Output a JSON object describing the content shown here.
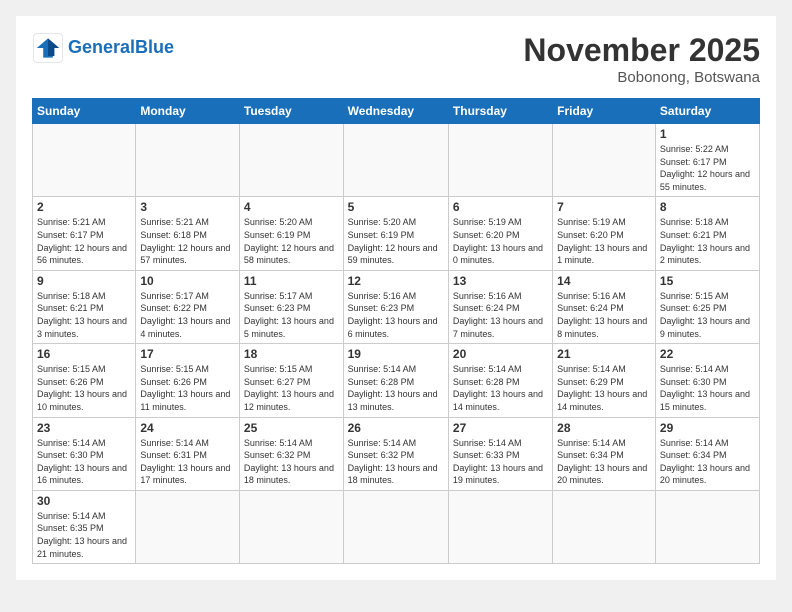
{
  "header": {
    "logo_general": "General",
    "logo_blue": "Blue",
    "month_title": "November 2025",
    "location": "Bobonong, Botswana"
  },
  "days_of_week": [
    "Sunday",
    "Monday",
    "Tuesday",
    "Wednesday",
    "Thursday",
    "Friday",
    "Saturday"
  ],
  "weeks": [
    [
      {
        "day": "",
        "info": ""
      },
      {
        "day": "",
        "info": ""
      },
      {
        "day": "",
        "info": ""
      },
      {
        "day": "",
        "info": ""
      },
      {
        "day": "",
        "info": ""
      },
      {
        "day": "",
        "info": ""
      },
      {
        "day": "1",
        "info": "Sunrise: 5:22 AM\nSunset: 6:17 PM\nDaylight: 12 hours and 55 minutes."
      }
    ],
    [
      {
        "day": "2",
        "info": "Sunrise: 5:21 AM\nSunset: 6:17 PM\nDaylight: 12 hours and 56 minutes."
      },
      {
        "day": "3",
        "info": "Sunrise: 5:21 AM\nSunset: 6:18 PM\nDaylight: 12 hours and 57 minutes."
      },
      {
        "day": "4",
        "info": "Sunrise: 5:20 AM\nSunset: 6:19 PM\nDaylight: 12 hours and 58 minutes."
      },
      {
        "day": "5",
        "info": "Sunrise: 5:20 AM\nSunset: 6:19 PM\nDaylight: 12 hours and 59 minutes."
      },
      {
        "day": "6",
        "info": "Sunrise: 5:19 AM\nSunset: 6:20 PM\nDaylight: 13 hours and 0 minutes."
      },
      {
        "day": "7",
        "info": "Sunrise: 5:19 AM\nSunset: 6:20 PM\nDaylight: 13 hours and 1 minute."
      },
      {
        "day": "8",
        "info": "Sunrise: 5:18 AM\nSunset: 6:21 PM\nDaylight: 13 hours and 2 minutes."
      }
    ],
    [
      {
        "day": "9",
        "info": "Sunrise: 5:18 AM\nSunset: 6:21 PM\nDaylight: 13 hours and 3 minutes."
      },
      {
        "day": "10",
        "info": "Sunrise: 5:17 AM\nSunset: 6:22 PM\nDaylight: 13 hours and 4 minutes."
      },
      {
        "day": "11",
        "info": "Sunrise: 5:17 AM\nSunset: 6:23 PM\nDaylight: 13 hours and 5 minutes."
      },
      {
        "day": "12",
        "info": "Sunrise: 5:16 AM\nSunset: 6:23 PM\nDaylight: 13 hours and 6 minutes."
      },
      {
        "day": "13",
        "info": "Sunrise: 5:16 AM\nSunset: 6:24 PM\nDaylight: 13 hours and 7 minutes."
      },
      {
        "day": "14",
        "info": "Sunrise: 5:16 AM\nSunset: 6:24 PM\nDaylight: 13 hours and 8 minutes."
      },
      {
        "day": "15",
        "info": "Sunrise: 5:15 AM\nSunset: 6:25 PM\nDaylight: 13 hours and 9 minutes."
      }
    ],
    [
      {
        "day": "16",
        "info": "Sunrise: 5:15 AM\nSunset: 6:26 PM\nDaylight: 13 hours and 10 minutes."
      },
      {
        "day": "17",
        "info": "Sunrise: 5:15 AM\nSunset: 6:26 PM\nDaylight: 13 hours and 11 minutes."
      },
      {
        "day": "18",
        "info": "Sunrise: 5:15 AM\nSunset: 6:27 PM\nDaylight: 13 hours and 12 minutes."
      },
      {
        "day": "19",
        "info": "Sunrise: 5:14 AM\nSunset: 6:28 PM\nDaylight: 13 hours and 13 minutes."
      },
      {
        "day": "20",
        "info": "Sunrise: 5:14 AM\nSunset: 6:28 PM\nDaylight: 13 hours and 14 minutes."
      },
      {
        "day": "21",
        "info": "Sunrise: 5:14 AM\nSunset: 6:29 PM\nDaylight: 13 hours and 14 minutes."
      },
      {
        "day": "22",
        "info": "Sunrise: 5:14 AM\nSunset: 6:30 PM\nDaylight: 13 hours and 15 minutes."
      }
    ],
    [
      {
        "day": "23",
        "info": "Sunrise: 5:14 AM\nSunset: 6:30 PM\nDaylight: 13 hours and 16 minutes."
      },
      {
        "day": "24",
        "info": "Sunrise: 5:14 AM\nSunset: 6:31 PM\nDaylight: 13 hours and 17 minutes."
      },
      {
        "day": "25",
        "info": "Sunrise: 5:14 AM\nSunset: 6:32 PM\nDaylight: 13 hours and 18 minutes."
      },
      {
        "day": "26",
        "info": "Sunrise: 5:14 AM\nSunset: 6:32 PM\nDaylight: 13 hours and 18 minutes."
      },
      {
        "day": "27",
        "info": "Sunrise: 5:14 AM\nSunset: 6:33 PM\nDaylight: 13 hours and 19 minutes."
      },
      {
        "day": "28",
        "info": "Sunrise: 5:14 AM\nSunset: 6:34 PM\nDaylight: 13 hours and 20 minutes."
      },
      {
        "day": "29",
        "info": "Sunrise: 5:14 AM\nSunset: 6:34 PM\nDaylight: 13 hours and 20 minutes."
      }
    ],
    [
      {
        "day": "30",
        "info": "Sunrise: 5:14 AM\nSunset: 6:35 PM\nDaylight: 13 hours and 21 minutes."
      },
      {
        "day": "",
        "info": ""
      },
      {
        "day": "",
        "info": ""
      },
      {
        "day": "",
        "info": ""
      },
      {
        "day": "",
        "info": ""
      },
      {
        "day": "",
        "info": ""
      },
      {
        "day": "",
        "info": ""
      }
    ]
  ]
}
